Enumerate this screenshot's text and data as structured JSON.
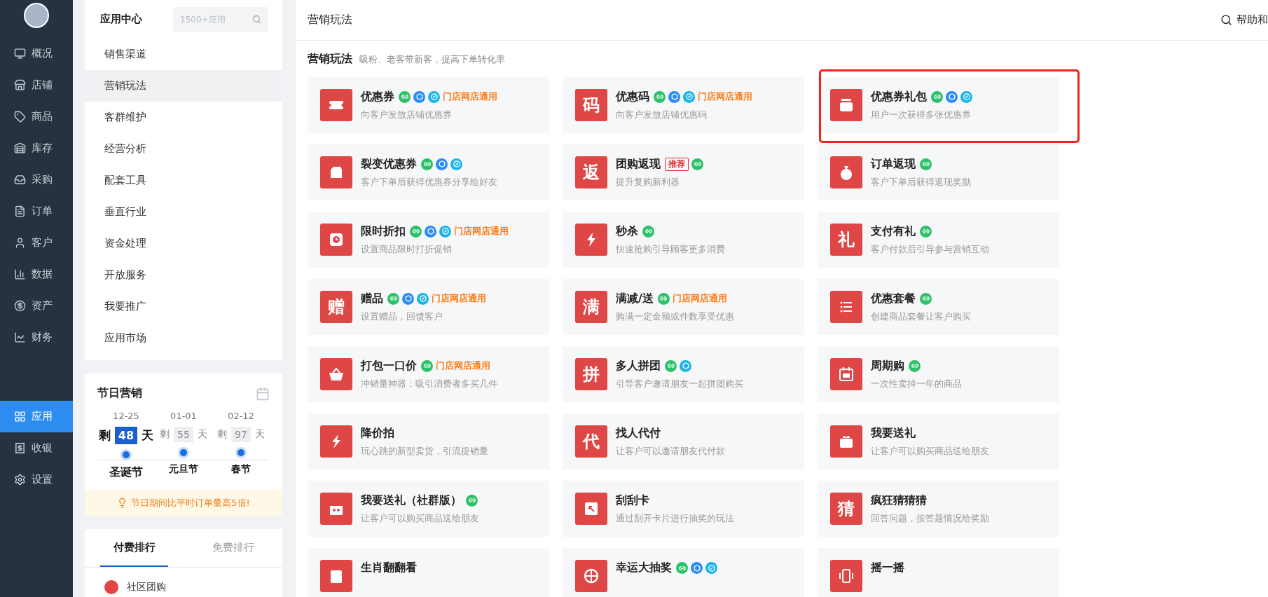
{
  "nav": {
    "main": [
      {
        "label": "概况",
        "selected": false
      },
      {
        "label": "店铺",
        "selected": false
      },
      {
        "label": "商品",
        "selected": false
      },
      {
        "label": "库存",
        "selected": false
      },
      {
        "label": "采购",
        "selected": false
      },
      {
        "label": "订单",
        "selected": false
      },
      {
        "label": "客户",
        "selected": false
      },
      {
        "label": "数据",
        "selected": false
      },
      {
        "label": "资产",
        "selected": false
      },
      {
        "label": "财务",
        "selected": false
      }
    ],
    "bottom": [
      {
        "label": "应用",
        "selected": true
      },
      {
        "label": "收银",
        "selected": false
      },
      {
        "label": "设置",
        "selected": false
      }
    ]
  },
  "app_center": {
    "title": "应用中心",
    "search": {
      "placeholder": "1500+应用"
    },
    "menu": [
      {
        "label": "销售渠道",
        "selected": false
      },
      {
        "label": "营销玩法",
        "selected": true
      },
      {
        "label": "客群维护",
        "selected": false
      },
      {
        "label": "经营分析",
        "selected": false
      },
      {
        "label": "配套工具",
        "selected": false
      },
      {
        "label": "垂直行业",
        "selected": false
      },
      {
        "label": "资金处理",
        "selected": false
      },
      {
        "label": "开放服务",
        "selected": false
      },
      {
        "label": "我要推广",
        "selected": false
      },
      {
        "label": "应用市场",
        "selected": false
      }
    ]
  },
  "festival": {
    "title": "节日营销",
    "items": [
      {
        "date": "12-25",
        "prefix": "剩",
        "days": "48",
        "unit": "天",
        "name": "圣诞节",
        "selected": true
      },
      {
        "date": "01-01",
        "prefix": "剩",
        "days": "55",
        "unit": "天",
        "name": "元旦节",
        "selected": false
      },
      {
        "date": "02-12",
        "prefix": "剩",
        "days": "97",
        "unit": "天",
        "name": "春节",
        "selected": false
      }
    ],
    "tip": "节日期间比平时订单量高5倍!"
  },
  "ranking": {
    "tabs": [
      {
        "label": "付费排行",
        "selected": true
      },
      {
        "label": "免费排行",
        "selected": false
      }
    ],
    "items": [
      "社区团购"
    ]
  },
  "header": {
    "title": "营销玩法",
    "help": "帮助和"
  },
  "section": {
    "title": "营销玩法",
    "subtitle": "吸粉、老客带新客，提高下单转化率"
  },
  "cards": [
    {
      "title": "优惠券",
      "desc": "向客户发放店铺优惠券",
      "icon": {
        "kind": "drawing"
      },
      "badges": [
        {
          "color": "#2fc16a"
        },
        {
          "color": "#2c8cf5"
        },
        {
          "color": "#1cb4e8"
        }
      ],
      "tag": {
        "kind": "store",
        "text": "门店网店通用"
      },
      "highlighted": false
    },
    {
      "title": "优惠码",
      "desc": "向客户发放店铺优惠码",
      "icon": {
        "kind": "char",
        "char": "码"
      },
      "badges": [
        {
          "color": "#2fc16a"
        },
        {
          "color": "#2c8cf5"
        },
        {
          "color": "#1cb4e8"
        }
      ],
      "tag": {
        "kind": "store",
        "text": "门店网店通用"
      },
      "highlighted": false
    },
    {
      "title": "优惠券礼包",
      "desc": "用户一次获得多张优惠券",
      "icon": {
        "kind": "drawing"
      },
      "badges": [
        {
          "color": "#2fc16a"
        },
        {
          "color": "#2c8cf5"
        },
        {
          "color": "#1cb4e8"
        }
      ],
      "highlighted": true
    },
    {
      "title": "裂变优惠券",
      "desc": "客户下单后获得优惠券分享给好友",
      "icon": {
        "kind": "drawing"
      },
      "badges": [
        {
          "color": "#2fc16a"
        },
        {
          "color": "#2c8cf5"
        },
        {
          "color": "#1cb4e8"
        }
      ],
      "highlighted": false
    },
    {
      "title": "团购返现",
      "desc": "提升复购新利器",
      "icon": {
        "kind": "char",
        "char": "返"
      },
      "badges": [
        {
          "color": "#2fc16a"
        }
      ],
      "tag": {
        "kind": "recommend",
        "text": "推荐"
      },
      "highlighted": false
    },
    {
      "title": "订单返现",
      "desc": "客户下单后获得返现奖励",
      "icon": {
        "kind": "drawing"
      },
      "badges": [
        {
          "color": "#2fc16a"
        }
      ],
      "highlighted": false
    },
    {
      "title": "限时折扣",
      "desc": "设置商品限时打折促销",
      "icon": {
        "kind": "drawing"
      },
      "badges": [
        {
          "color": "#2fc16a"
        },
        {
          "color": "#2c8cf5"
        },
        {
          "color": "#1cb4e8"
        }
      ],
      "tag": {
        "kind": "store",
        "text": "门店网店通用"
      },
      "highlighted": false
    },
    {
      "title": "秒杀",
      "desc": "快速抢购引导顾客更多消费",
      "icon": {
        "kind": "drawing"
      },
      "badges": [
        {
          "color": "#2fc16a"
        }
      ],
      "highlighted": false
    },
    {
      "title": "支付有礼",
      "desc": "客户付款后引导参与营销互动",
      "icon": {
        "kind": "char",
        "char": "礼"
      },
      "badges": [
        {
          "color": "#2fc16a"
        }
      ],
      "highlighted": false
    },
    {
      "title": "赠品",
      "desc": "设置赠品，回馈客户",
      "icon": {
        "kind": "char",
        "char": "赠"
      },
      "badges": [
        {
          "color": "#2fc16a"
        },
        {
          "color": "#2c8cf5"
        },
        {
          "color": "#1cb4e8"
        }
      ],
      "tag": {
        "kind": "store",
        "text": "门店网店通用"
      },
      "highlighted": false
    },
    {
      "title": "满减/送",
      "desc": "购满一定金额或件数享受优惠",
      "icon": {
        "kind": "char",
        "char": "满"
      },
      "badges": [
        {
          "color": "#2fc16a"
        }
      ],
      "tag": {
        "kind": "store",
        "text": "门店网店通用"
      },
      "highlighted": false
    },
    {
      "title": "优惠套餐",
      "desc": "创建商品套餐让客户购买",
      "icon": {
        "kind": "drawing"
      },
      "badges": [
        {
          "color": "#2fc16a"
        }
      ],
      "highlighted": false
    },
    {
      "title": "打包一口价",
      "desc": "冲销量神器：吸引消费者多买几件",
      "icon": {
        "kind": "drawing"
      },
      "badges": [
        {
          "color": "#2fc16a"
        }
      ],
      "tag": {
        "kind": "store",
        "text": "门店网店通用"
      },
      "highlighted": false
    },
    {
      "title": "多人拼团",
      "desc": "引导客户邀请朋友一起拼团购买",
      "icon": {
        "kind": "char",
        "char": "拼"
      },
      "badges": [
        {
          "color": "#2fc16a"
        },
        {
          "color": "#1cb4e8"
        }
      ],
      "highlighted": false
    },
    {
      "title": "周期购",
      "desc": "一次性卖掉一年的商品",
      "icon": {
        "kind": "drawing"
      },
      "badges": [
        {
          "color": "#2fc16a"
        }
      ],
      "highlighted": false
    },
    {
      "title": "降价拍",
      "desc": "玩心跳的新型卖货，引流提销量",
      "icon": {
        "kind": "drawing"
      },
      "highlighted": false
    },
    {
      "title": "找人代付",
      "desc": "让客户可以邀请朋友代付款",
      "icon": {
        "kind": "char",
        "char": "代"
      },
      "highlighted": false
    },
    {
      "title": "我要送礼",
      "desc": "让客户可以购买商品送给朋友",
      "icon": {
        "kind": "drawing"
      },
      "highlighted": false
    },
    {
      "title": "我要送礼（社群版）",
      "desc": "让客户可以购买商品送给朋友",
      "icon": {
        "kind": "drawing"
      },
      "badges": [
        {
          "color": "#2fc16a"
        }
      ],
      "highlighted": false
    },
    {
      "title": "刮刮卡",
      "desc": "通过刮开卡片进行抽奖的玩法",
      "icon": {
        "kind": "drawing"
      },
      "highlighted": false
    },
    {
      "title": "疯狂猜猜猜",
      "desc": "回答问题，按答题情况给奖励",
      "icon": {
        "kind": "char",
        "char": "猜"
      },
      "highlighted": false
    },
    {
      "title": "生肖翻翻看",
      "icon": {
        "kind": "drawing"
      },
      "highlighted": false
    },
    {
      "title": "幸运大抽奖",
      "icon": {
        "kind": "drawing"
      },
      "badges": [
        {
          "color": "#2fc16a"
        },
        {
          "color": "#2c8cf5"
        },
        {
          "color": "#1cb4e8"
        }
      ],
      "highlighted": false
    },
    {
      "title": "摇一摇",
      "icon": {
        "kind": "drawing"
      },
      "highlighted": false
    }
  ]
}
